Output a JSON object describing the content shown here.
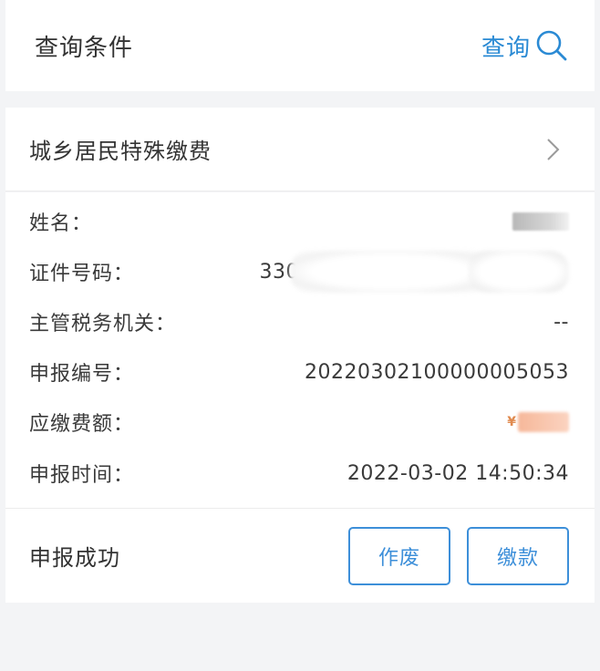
{
  "header": {
    "title": "查询条件",
    "query_label": "查询",
    "query_icon": "search-icon"
  },
  "category": {
    "label": "城乡居民特殊缴费",
    "chevron_icon": "chevron-right-icon"
  },
  "info": {
    "name_label": "姓名：",
    "id_label": "证件号码：",
    "id_value_prefix": "330",
    "tax_office_label": "主管税务机关：",
    "tax_office_value": "--",
    "declaration_no_label": "申报编号：",
    "declaration_no_value": "20220302100000005053",
    "amount_label": "应缴费额：",
    "amount_mark": "¥",
    "declaration_time_label": "申报时间：",
    "declaration_time_value": "2022-03-02 14:50:34"
  },
  "footer": {
    "status": "申报成功",
    "void_label": "作废",
    "pay_label": "缴款"
  },
  "colors": {
    "accent": "#3d8fd9",
    "background": "#f3f4f6",
    "text": "#333333"
  }
}
